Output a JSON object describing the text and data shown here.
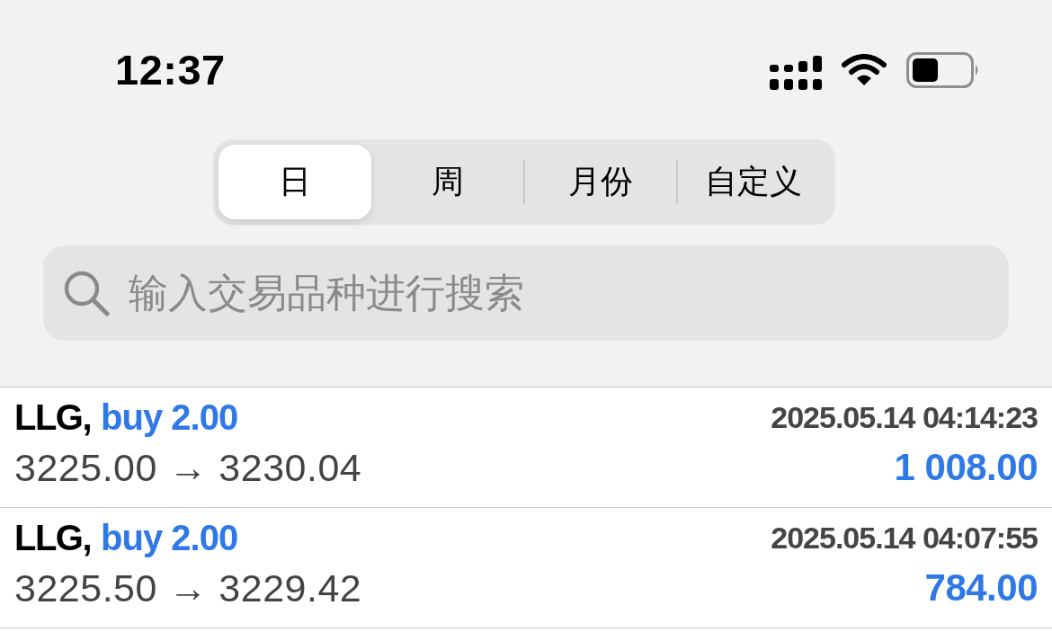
{
  "status_bar": {
    "time": "12:37"
  },
  "tabs": [
    {
      "label": "日",
      "selected": true
    },
    {
      "label": "周",
      "selected": false
    },
    {
      "label": "月份",
      "selected": false
    },
    {
      "label": "自定义",
      "selected": false
    }
  ],
  "search": {
    "placeholder": "输入交易品种进行搜索"
  },
  "trades": [
    {
      "symbol": "LLG,",
      "order": "buy 2.00",
      "time": "2025.05.14 04:14:23",
      "prices": "3225.00 → 3230.04",
      "profit": "1 008.00"
    },
    {
      "symbol": "LLG,",
      "order": "buy 2.00",
      "time": "2025.05.14 04:07:55",
      "prices": "3225.50 → 3229.42",
      "profit": "784.00"
    }
  ]
}
